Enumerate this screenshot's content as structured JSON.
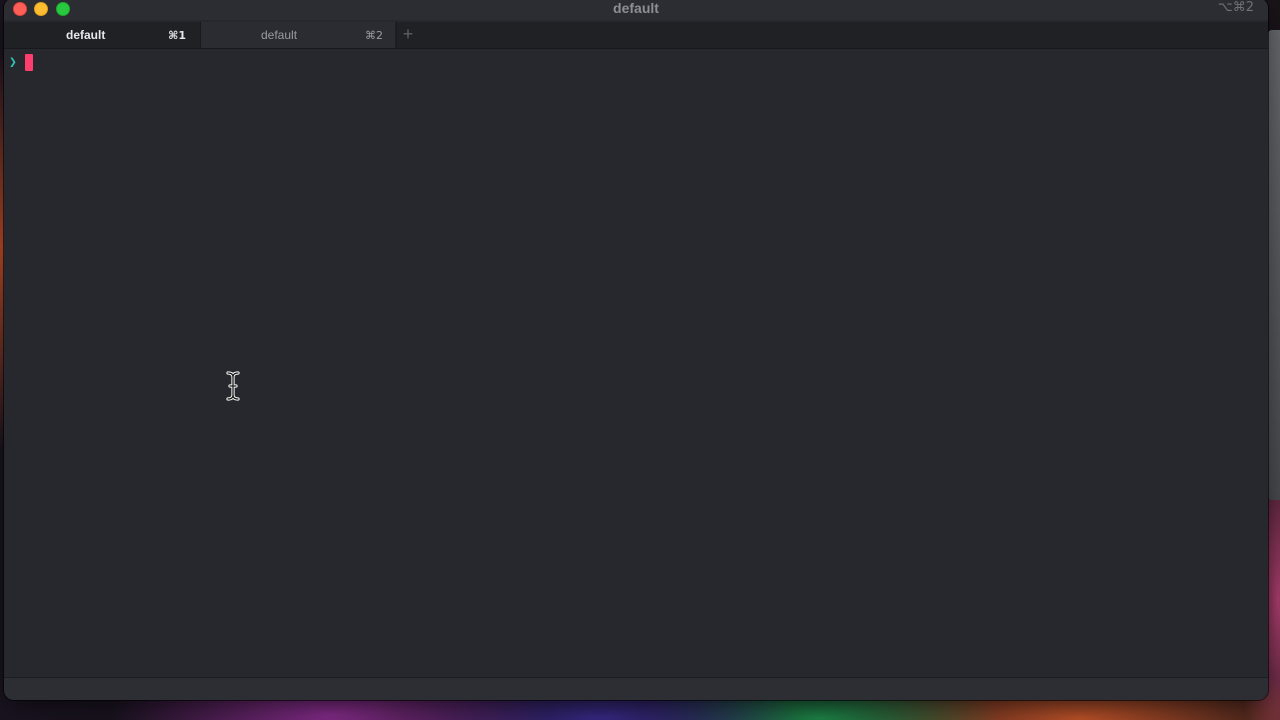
{
  "window": {
    "title": "default",
    "shortcut": "⌥⌘2"
  },
  "tabs": [
    {
      "label": "default",
      "shortcut": "⌘1",
      "active": true
    },
    {
      "label": "default",
      "shortcut": "⌘2",
      "active": false
    }
  ],
  "new_tab_symbol": "+",
  "terminal": {
    "prompt_symbol": "❯",
    "input_text": ""
  },
  "icons": {
    "close": "red-circle",
    "minimize": "yellow-circle",
    "maximize": "green-circle",
    "mouse_cursor": "i-beam"
  },
  "colors": {
    "prompt": "#2ec4b6",
    "cursor": "#ff3d6e",
    "background": "#26282d"
  }
}
